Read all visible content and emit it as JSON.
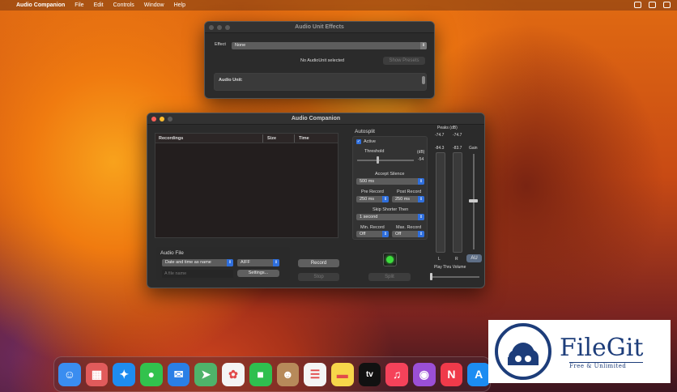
{
  "menubar": {
    "app_name": "Audio Companion",
    "items": [
      "File",
      "Edit",
      "Controls",
      "Window",
      "Help"
    ]
  },
  "effects_window": {
    "title": "Audio Unit Effects",
    "effect_label": "Effect",
    "effect_value": "None",
    "status_text": "No AudioUnit selected",
    "show_presets_label": "Show Presets",
    "audio_unit_label": "Audio Unit:"
  },
  "main_window": {
    "title": "Audio Companion",
    "recordings": {
      "columns": [
        "Recordings",
        "Size",
        "Time"
      ],
      "rows": []
    },
    "audio_file": {
      "label": "Audio File",
      "naming_value": "Date and time as name",
      "format_value": "AIFF",
      "file_name_placeholder": "A file name",
      "settings_label": "Settings..."
    },
    "record_label": "Record",
    "stop_label": "Stop",
    "split_label": "Split",
    "autosplit": {
      "title": "Autosplit",
      "active_label": "Active",
      "active_checked": true,
      "threshold_label": "Threshold",
      "threshold_unit": "(dB)",
      "threshold_value": "-54",
      "threshold_level": 0.45,
      "accept_silence_label": "Accept Silence",
      "accept_silence_value": "500 ms",
      "pre_record_label": "Pre Record",
      "pre_record_value": "250 ms",
      "post_record_label": "Post Record",
      "post_record_value": "250 ms",
      "skip_shorter_label": "Skip Shorter Then",
      "skip_shorter_value": "1 second",
      "min_record_label": "Min. Record",
      "min_record_value": "Off",
      "max_record_label": "Max. Record",
      "max_record_value": "Off"
    },
    "meters": {
      "peaks_label": "Peaks (dB)",
      "peak_left": "-74.7",
      "peak_right": "-74.7",
      "level_left": "-84.3",
      "level_right": "-83.7",
      "gain_label": "Gain",
      "gain_level": 0.55,
      "left_label": "L",
      "right_label": "R",
      "au_label": "AU",
      "play_thru_label": "Play Thru Volume",
      "play_thru_level": 0.0
    },
    "indicator_color": "#3ddc3d"
  },
  "dock": {
    "apps": [
      {
        "name": "Finder",
        "icon": "finder-icon",
        "glyph": "☺",
        "color": "#3a8df0"
      },
      {
        "name": "Launchpad",
        "icon": "launchpad-icon",
        "glyph": "▦",
        "color": "#e15b5b"
      },
      {
        "name": "Safari",
        "icon": "safari-icon",
        "glyph": "✦",
        "color": "#1e8cf0"
      },
      {
        "name": "Messages",
        "icon": "messages-icon",
        "glyph": "●",
        "color": "#32c24d"
      },
      {
        "name": "Mail",
        "icon": "mail-icon",
        "glyph": "✉",
        "color": "#2a7fe6"
      },
      {
        "name": "Maps",
        "icon": "maps-icon",
        "glyph": "➤",
        "color": "#4fb36a"
      },
      {
        "name": "Photos",
        "icon": "photos-icon",
        "glyph": "✿",
        "color": "#f4f4f4"
      },
      {
        "name": "FaceTime",
        "icon": "facetime-icon",
        "glyph": "■",
        "color": "#2fbf4f"
      },
      {
        "name": "Contacts",
        "icon": "contacts-icon",
        "glyph": "☻",
        "color": "#b78a5a"
      },
      {
        "name": "Reminders",
        "icon": "reminders-icon",
        "glyph": "☰",
        "color": "#f4f4f4"
      },
      {
        "name": "Notes",
        "icon": "notes-icon",
        "glyph": "▬",
        "color": "#f7d64a"
      },
      {
        "name": "TV",
        "icon": "tv-icon",
        "glyph": "tv",
        "color": "#111111"
      },
      {
        "name": "Music",
        "icon": "music-icon",
        "glyph": "♫",
        "color": "#f5425a"
      },
      {
        "name": "Podcasts",
        "icon": "podcasts-icon",
        "glyph": "◉",
        "color": "#9b4fd6"
      },
      {
        "name": "News",
        "icon": "news-icon",
        "glyph": "N",
        "color": "#f03a4a"
      },
      {
        "name": "App Store",
        "icon": "app-store-icon",
        "glyph": "A",
        "color": "#1c8cf2"
      }
    ]
  },
  "watermark": {
    "brand": "FileGit",
    "tagline": "Free & Unlimited"
  }
}
